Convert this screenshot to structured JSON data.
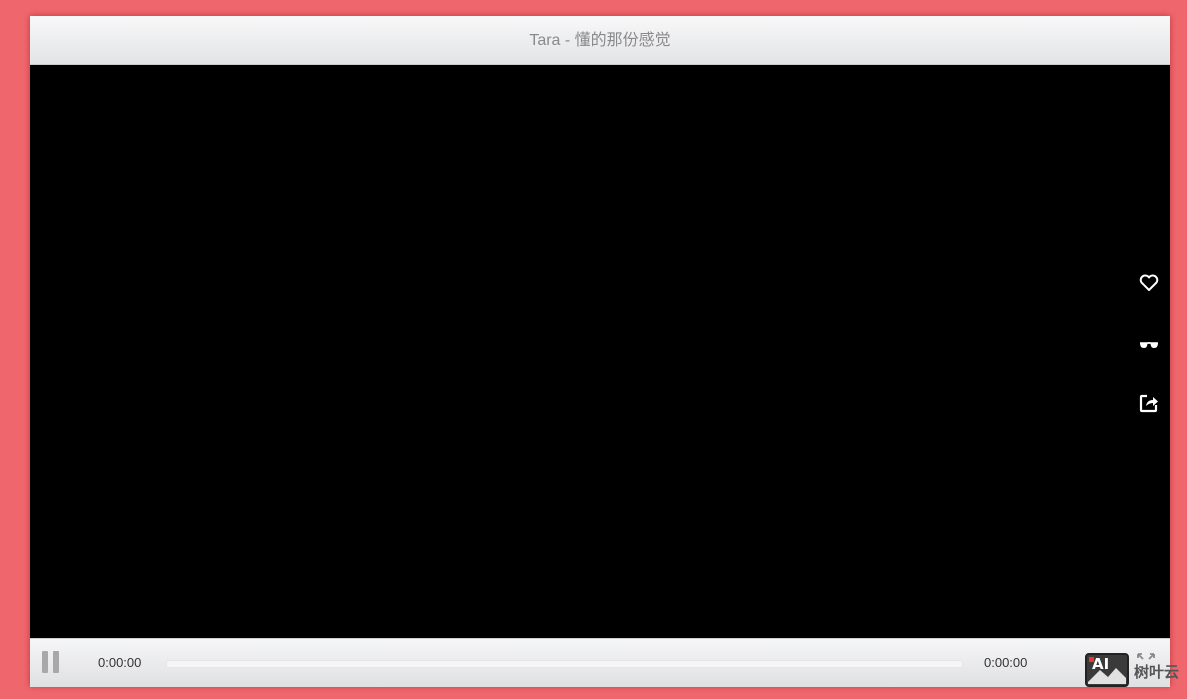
{
  "player": {
    "title": "Tara - 懂的那份感觉",
    "side_actions": [
      {
        "name": "like",
        "icon": "heart-icon"
      },
      {
        "name": "watch",
        "icon": "glasses-icon"
      },
      {
        "name": "share",
        "icon": "share-icon"
      }
    ],
    "controls": {
      "current_time": "0:00:00",
      "total_time": "0:00:00",
      "progress": 0,
      "pause_icon": "pause-icon",
      "fullscreen_icon": "fullscreen-icon"
    }
  },
  "watermark": {
    "logo_text": "AI",
    "brand_text": "树叶云"
  },
  "colors": {
    "background": "#f0666d",
    "video": "#000000",
    "title_text": "#8a8a8a"
  }
}
